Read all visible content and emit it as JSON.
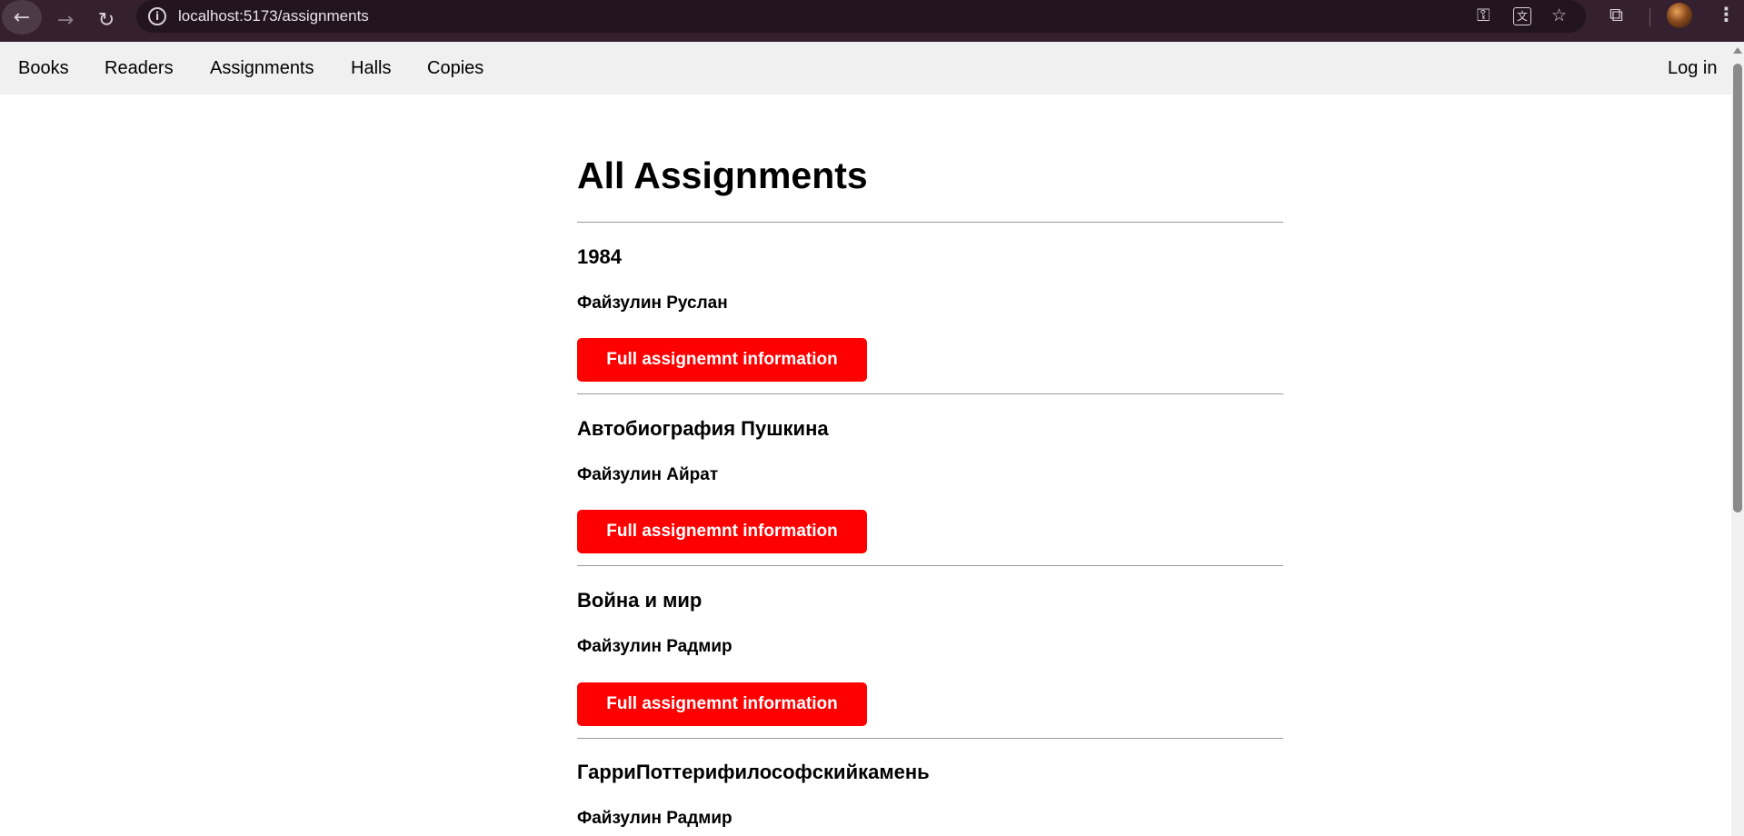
{
  "browser": {
    "url": "localhost:5173/assignments",
    "icons": [
      "back-arrow-icon",
      "forward-arrow-icon",
      "reload-icon",
      "site-info-icon",
      "key-icon",
      "translate-icon",
      "star-icon",
      "extensions-icon",
      "profile-avatar",
      "kebab-menu-icon"
    ]
  },
  "nav": {
    "links": [
      "Books",
      "Readers",
      "Assignments",
      "Halls",
      "Copies"
    ],
    "login": "Log in"
  },
  "page": {
    "title": "All Assignments"
  },
  "assignments": [
    {
      "book": "1984",
      "reader": "Файзулин Руслан",
      "button": "Full assignemnt information"
    },
    {
      "book": "Автобиография Пушкина",
      "reader": "Файзулин Айрат",
      "button": "Full assignemnt information"
    },
    {
      "book": "Война и мир",
      "reader": "Файзулин Радмир",
      "button": "Full assignemnt information"
    },
    {
      "book": "ГарриПоттерифилософскийкамень",
      "reader": "Файзулин Радмир",
      "button": "Full assignemnt information"
    }
  ],
  "colors": {
    "button_bg": "#ff0000",
    "button_text": "#ffffff",
    "nav_bg": "#f0f0f0",
    "chrome_bg": "#35202f"
  }
}
